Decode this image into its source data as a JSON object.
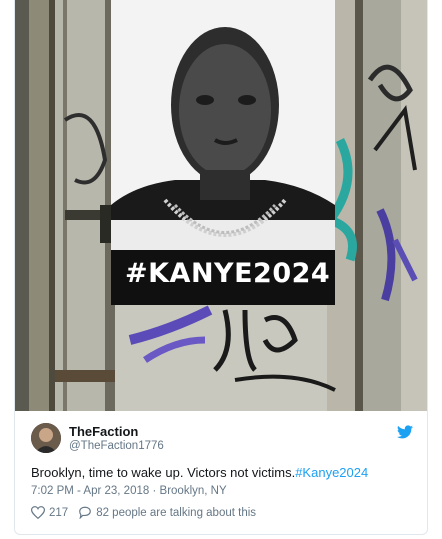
{
  "poster": {
    "hashtag_text": "#KANYE2024"
  },
  "tweet": {
    "display_name": "TheFaction",
    "handle": "@TheFaction1776",
    "text_prefix": "Brooklyn, time to wake up. Victors not victims.",
    "hashtag": "#Kanye2024",
    "timestamp": "7:02 PM - Apr 23, 2018",
    "separator": "·",
    "location": "Brooklyn, NY",
    "like_count": "217",
    "talking_text": "82 people are talking about this"
  },
  "colors": {
    "accent": "#1da1f2",
    "muted": "#657786",
    "text": "#14171a",
    "border": "#e1e8ed"
  },
  "icons": [
    "twitter-bird-icon",
    "heart-icon",
    "reply-bubble-icon"
  ]
}
